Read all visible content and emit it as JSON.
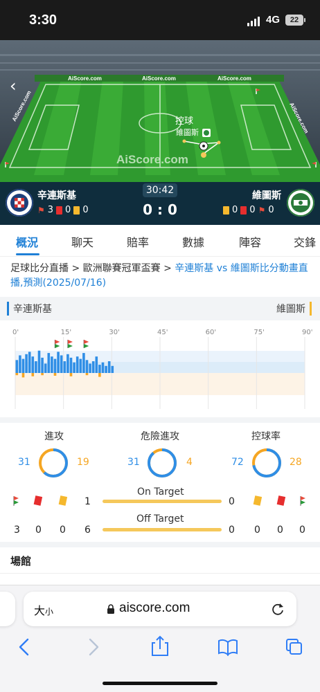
{
  "status": {
    "time": "3:30",
    "network": "4G",
    "battery": "22"
  },
  "pitch": {
    "ads": [
      "AiScore.com",
      "AiScore.com",
      "AiScore.com",
      "AiScore.com",
      "AiScore.com"
    ],
    "watermark": "AiScore.com",
    "event": "控球",
    "event_team": "維圖斯"
  },
  "match": {
    "clock": "30:42",
    "score": "0 : 0",
    "home": {
      "name": "辛連斯基",
      "corners": "3",
      "red": "0",
      "yellow": "0"
    },
    "away": {
      "name": "維圖斯",
      "yellow": "0",
      "red": "0",
      "corners": "0"
    }
  },
  "tabs": [
    {
      "label": "概況",
      "active": true
    },
    {
      "label": "聊天"
    },
    {
      "label": "賠率"
    },
    {
      "label": "數據"
    },
    {
      "label": "陣容"
    },
    {
      "label": "交鋒"
    }
  ],
  "breadcrumb": {
    "part1": "足球比分直播",
    "sep1": " > ",
    "part2": "歐洲聯賽冠軍盃賽",
    "sep2": " > ",
    "link": "辛連斯基 vs 維圖斯比分動畫直播,預測(2025/07/16)"
  },
  "timeline": {
    "home_label": "辛連斯基",
    "away_label": "維圖斯",
    "ticks": [
      "0'",
      "15'",
      "30'",
      "45'",
      "60'",
      "75'",
      "90'"
    ],
    "current_minute": 30.7,
    "home_pressure": [
      0.55,
      0.75,
      0.6,
      0.8,
      0.9,
      0.7,
      0.5,
      0.95,
      0.65,
      0.4,
      0.85,
      0.7,
      0.6,
      0.9,
      0.75,
      0.5,
      0.8,
      0.65,
      0.45,
      0.7,
      0.6,
      0.85,
      0.55,
      0.4,
      0.5,
      0.7,
      0.35,
      0.45,
      0.3,
      0.5,
      0.3
    ],
    "away_pressure": [
      0.2,
      0,
      0.4,
      0,
      0,
      0.3,
      0,
      0,
      0.2,
      0,
      0,
      0,
      0.25,
      0,
      0,
      0,
      0,
      0.3,
      0,
      0,
      0,
      0,
      0.2,
      0,
      0,
      0,
      0.35,
      0,
      0,
      0,
      0
    ],
    "corner_minutes": [
      13,
      17,
      22
    ]
  },
  "stats": {
    "items": [
      {
        "title": "進攻",
        "home": 31,
        "away": 19
      },
      {
        "title": "危險進攻",
        "home": 31,
        "away": 4
      },
      {
        "title": "控球率",
        "home": 72,
        "away": 28
      }
    ],
    "home_colors": {
      "primary": "#2f8ee6",
      "secondary": "#f5a623"
    }
  },
  "shots": {
    "on_target_label": "On Target",
    "off_target_label": "Off Target",
    "home_on": "1",
    "away_on": "0",
    "home_off": "6",
    "away_off": "0",
    "home_counts": [
      "3",
      "0",
      "0"
    ],
    "away_counts": [
      "0",
      "0",
      "0"
    ]
  },
  "venue_label": "場館",
  "browser": {
    "text_size": "大",
    "text_size_small": "小",
    "url": "aiscore.com"
  }
}
